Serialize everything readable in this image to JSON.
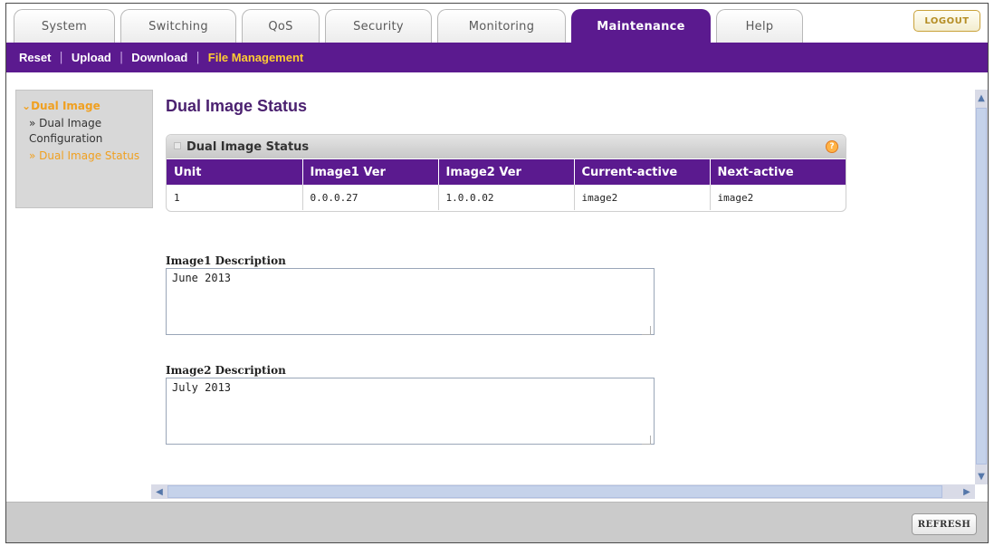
{
  "tabs": [
    {
      "label": "System"
    },
    {
      "label": "Switching"
    },
    {
      "label": "QoS"
    },
    {
      "label": "Security"
    },
    {
      "label": "Monitoring"
    },
    {
      "label": "Maintenance"
    },
    {
      "label": "Help"
    }
  ],
  "active_tab": "Maintenance",
  "logout_label": "LOGOUT",
  "subnav": {
    "items": [
      {
        "label": "Reset"
      },
      {
        "label": "Upload"
      },
      {
        "label": "Download"
      },
      {
        "label": "File Management"
      }
    ],
    "active": "File Management"
  },
  "leftnav": {
    "head": "Dual Image",
    "items": [
      {
        "label": "» Dual Image Configuration"
      },
      {
        "label": "» Dual Image Status"
      }
    ]
  },
  "page_title": "Dual Image Status",
  "panel": {
    "title": "Dual Image Status",
    "help_glyph": "?",
    "columns": [
      "Unit",
      "Image1 Ver",
      "Image2 Ver",
      "Current-active",
      "Next-active"
    ],
    "rows": [
      [
        "1",
        "0.0.0.27",
        "1.0.0.02",
        "image2",
        "image2"
      ]
    ]
  },
  "fields": {
    "image1": {
      "label": "Image1 Description",
      "value": "June 2013"
    },
    "image2": {
      "label": "Image2 Description",
      "value": "July 2013"
    }
  },
  "refresh_label": "REFRESH",
  "colors": {
    "accent": "#5b1a8f",
    "highlight": "#f0a020"
  }
}
